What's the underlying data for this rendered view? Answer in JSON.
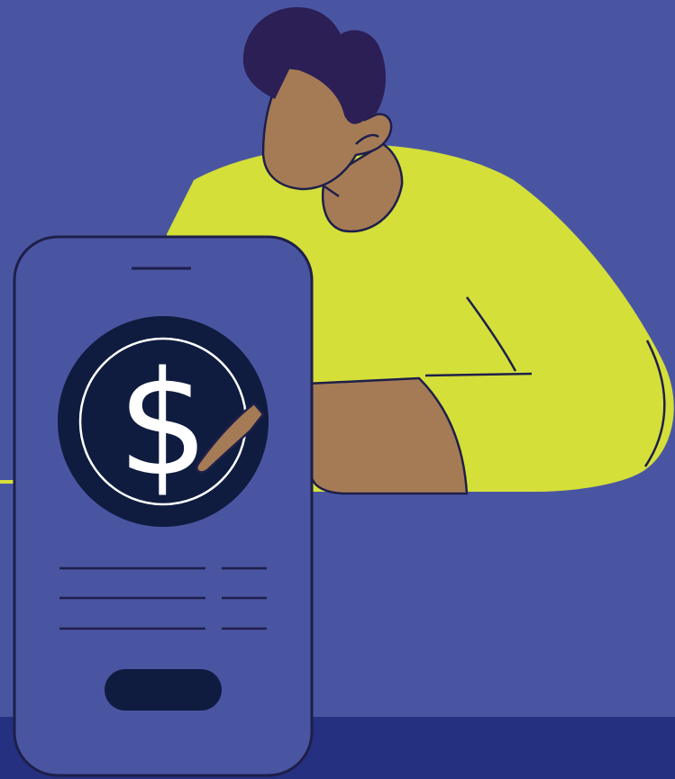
{
  "illustration": {
    "subject": "person-pointing-at-phone",
    "icons": {
      "phone": "smartphone-icon",
      "coin": "dollar-coin-icon",
      "button": "pill-button-icon"
    },
    "phone_screen": {
      "currency_symbol": "$",
      "detail_lines": 3
    },
    "colors": {
      "background": "#4a55a2",
      "floor": "#253080",
      "sweater": "#d4df3a",
      "skin": "#a57b56",
      "hair": "#2b1f56",
      "outline": "#1e1f4a",
      "coin": "#0f1c3f",
      "coin_symbol": "#ffffff",
      "phone_body": "#4a55a2",
      "accent_line": "#d4df3a"
    }
  }
}
